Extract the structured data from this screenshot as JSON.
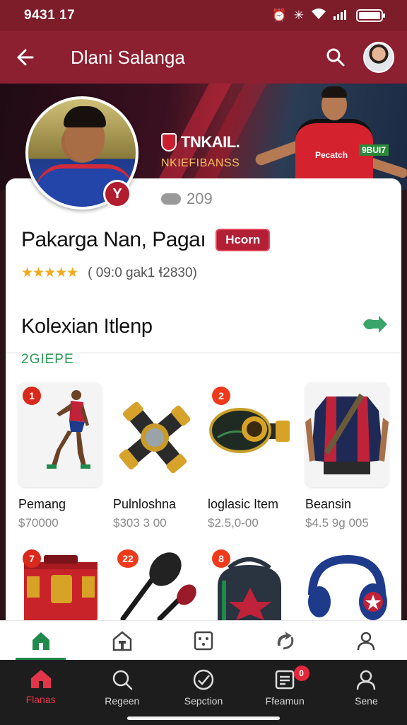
{
  "status_bar": {
    "time": "9431 17"
  },
  "app_bar": {
    "title": "Dlani Salanga"
  },
  "banner": {
    "brand": "TNKAIL.",
    "subbrand": "NKIEFIBANSS",
    "sponsor": "Pecatch",
    "tag": "9BUI7"
  },
  "profile": {
    "followers": "209",
    "name": "Pakarga Nan, Pagaı",
    "badge": "Hcorn",
    "stars": "★★★★★",
    "rating_text": "( 09:0 ɡak1 ɬ2830)"
  },
  "collection": {
    "title": "Kolexian Itlenp",
    "subtitle": "2GIEPE",
    "items": [
      {
        "num": "1",
        "label": "Pemang",
        "price": "$70000"
      },
      {
        "num": "",
        "label": "Pulnloshna",
        "price": "$303 3 00"
      },
      {
        "num": "2",
        "label": "loglasic Item",
        "price": "$2.5,0-00"
      },
      {
        "num": "",
        "label": "Beansin",
        "price": "$4.5 9g 005"
      },
      {
        "num": "7",
        "label": "",
        "price": ""
      },
      {
        "num": "22",
        "label": "",
        "price": ""
      },
      {
        "num": "8",
        "label": "",
        "price": ""
      },
      {
        "num": "",
        "label": "",
        "price": ""
      }
    ]
  },
  "bottom_nav": {
    "items": [
      {
        "label": "Flanas"
      },
      {
        "label": "Regeen"
      },
      {
        "label": "Sepction"
      },
      {
        "label": "Ffeamun",
        "badge": "0"
      },
      {
        "label": "Sene"
      }
    ]
  },
  "colors": {
    "brand": "#8c1f30",
    "accent": "#b31f35",
    "green": "#2b9a55"
  }
}
